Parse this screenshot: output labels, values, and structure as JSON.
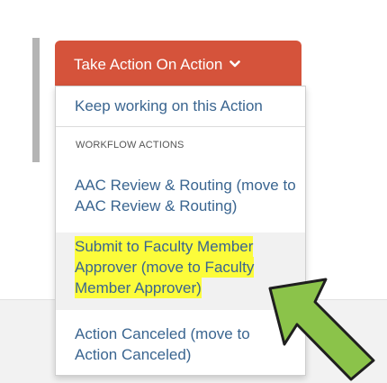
{
  "action_button": {
    "label": "Take Action On Action",
    "caret_icon": "chevron-down-icon",
    "color": "#d5533b"
  },
  "dropdown": {
    "keep_working_label": "Keep working on this Action",
    "section_header": "WORKFLOW ACTIONS",
    "items": [
      {
        "label": "AAC Review & Routing (move to AAC Review & Routing)"
      },
      {
        "label_lines": [
          "Submit to Faculty Member",
          "Approver (move to Faculty",
          "Member Approver)"
        ],
        "highlighted": true,
        "highlight_color": "#fcfc3a"
      },
      {
        "label": "Action Canceled (move to Action Canceled)"
      }
    ]
  },
  "annotation": {
    "arrow_icon": "pointer-arrow-icon",
    "color": "#8bc34a"
  },
  "colors": {
    "link": "#3a6590",
    "accent": "#d5533b"
  }
}
